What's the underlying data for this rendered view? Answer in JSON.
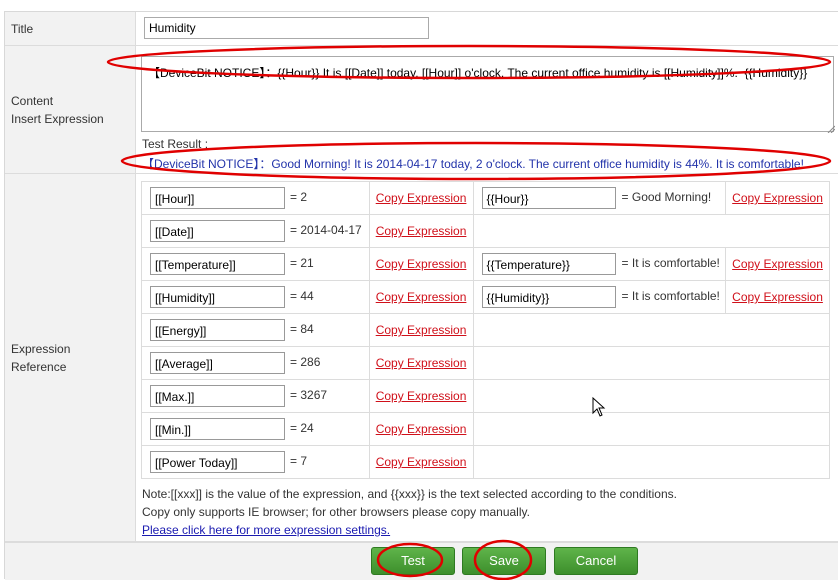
{
  "labels": {
    "title": "Title",
    "content": "Content",
    "insert_expression": "Insert Expression",
    "expression": "Expression",
    "reference": "Reference"
  },
  "title_value": "Humidity",
  "content_value": "【DeviceBit NOTICE】：{{Hour}} It is [[Date]] today, [[Hour]] o'clock. The current office humidity is [[Humidity]]%.  {{Humidity}}",
  "test_result": {
    "label": "Test Result :",
    "text": "【DeviceBit NOTICE】：Good Morning! It is 2014-04-17 today, 2 o'clock. The current office humidity is 44%. It is comfortable!"
  },
  "copy_label": "Copy Expression",
  "expressions": [
    {
      "expr": "[[Hour]]",
      "value": "= 2",
      "cond": "{{Hour}}",
      "cond_value": "= Good Morning!"
    },
    {
      "expr": "[[Date]]",
      "value": "= 2014-04-17"
    },
    {
      "expr": "[[Temperature]]",
      "value": "= 21",
      "cond": "{{Temperature}}",
      "cond_value": "= It is comfortable!"
    },
    {
      "expr": "[[Humidity]]",
      "value": "= 44",
      "cond": "{{Humidity}}",
      "cond_value": "= It is comfortable!"
    },
    {
      "expr": "[[Energy]]",
      "value": "= 84"
    },
    {
      "expr": "[[Average]]",
      "value": "= 286"
    },
    {
      "expr": "[[Max.]]",
      "value": "= 3267"
    },
    {
      "expr": "[[Min.]]",
      "value": "= 24"
    },
    {
      "expr": "[[Power Today]]",
      "value": "= 7"
    }
  ],
  "notes": {
    "line1": "Note:[[xxx]] is the value of the expression, and {{xxx}} is the text selected according to the conditions.",
    "line2": "Copy only supports IE browser; for other browsers please copy manually.",
    "link": "Please click here for more expression settings."
  },
  "buttons": {
    "test": "Test",
    "save": "Save",
    "cancel": "Cancel"
  },
  "colors": {
    "button_green": "#4aa33a",
    "annotation_red": "#e00000",
    "copy_link": "#d0101a",
    "test_result_text": "#2233aa"
  }
}
